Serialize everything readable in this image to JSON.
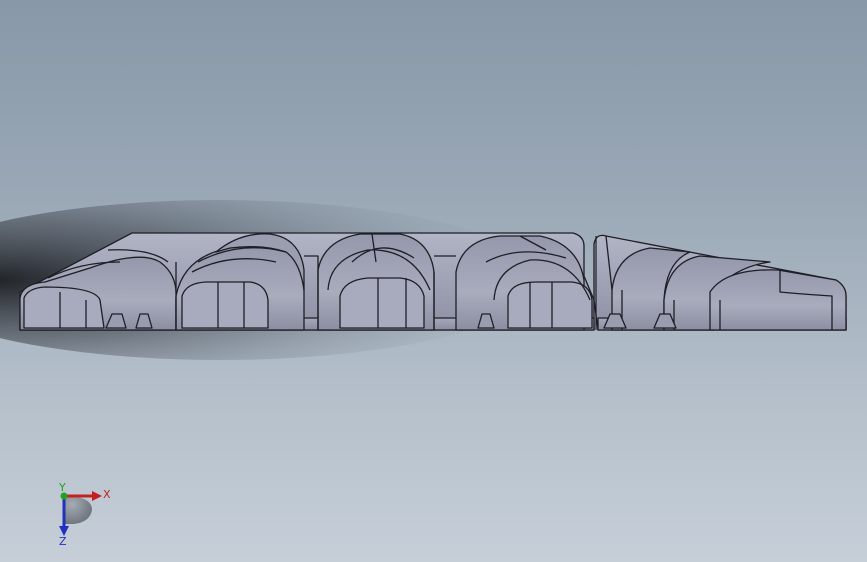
{
  "viewport": {
    "background_top": "#8898a8",
    "background_bottom": "#c6cfd8"
  },
  "model": {
    "face_color": "#a3a6b8",
    "face_dark": "#7c7f92",
    "face_light": "#b9bccc",
    "edge_color": "#1e1e26"
  },
  "triad": {
    "x_label": "X",
    "y_label": "Y",
    "z_label": "Z",
    "x_color": "#c42020",
    "y_color": "#22a022",
    "z_color": "#2030c0"
  }
}
